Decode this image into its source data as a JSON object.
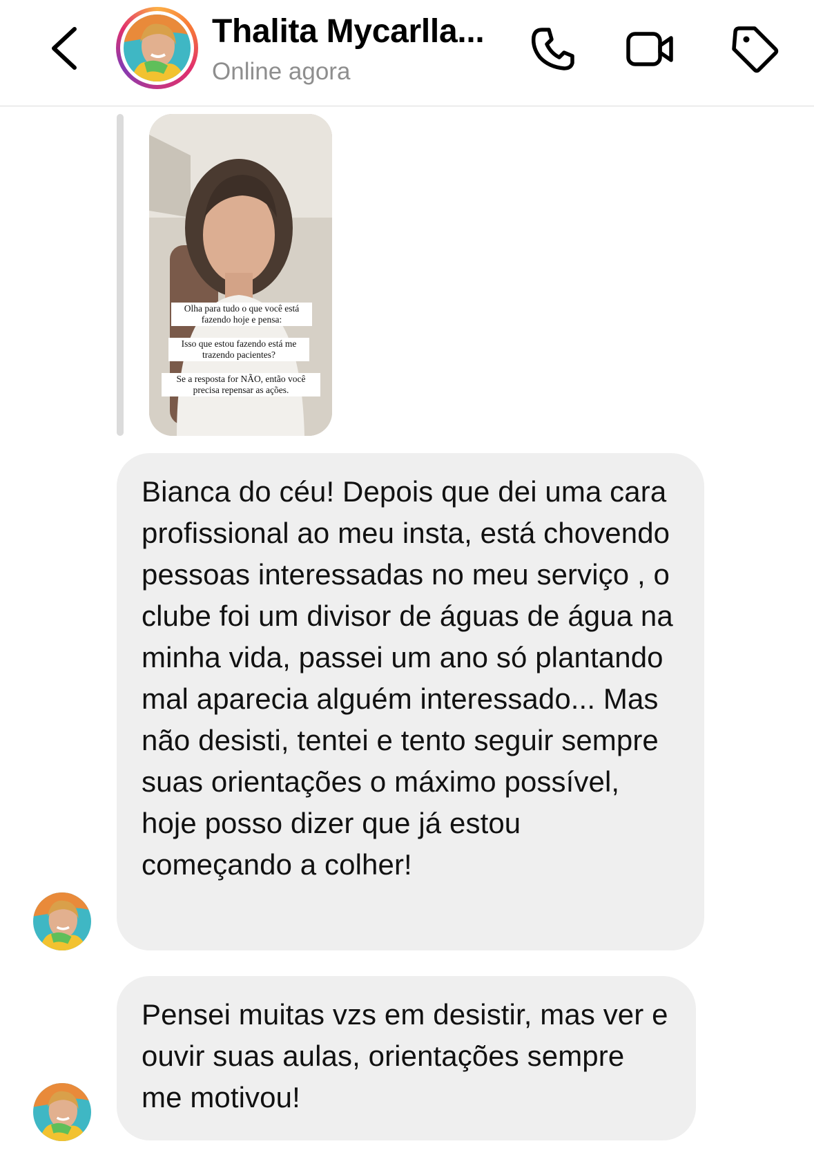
{
  "header": {
    "contact_name": "Thalita Mycarlla...",
    "status": "Online agora",
    "icons": [
      "back-chevron-icon",
      "phone-icon",
      "video-camera-icon",
      "tag-icon"
    ]
  },
  "story_reply": {
    "captions": [
      "Olha para tudo o que você está fazendo hoje e pensa:",
      "Isso que estou fazendo está me trazendo pacientes?",
      "Se a resposta for NÃO, então você precisa repensar as ações."
    ]
  },
  "messages": [
    {
      "text": "Bianca do céu! Depois que dei uma cara profissional ao meu insta, está chovendo pessoas interessadas no meu serviço , o clube foi um divisor de águas de água na minha vida, passei um ano só plantando mal aparecia alguém interessado... Mas não desisti, tentei e tento seguir sempre suas orientações o máximo possível, hoje posso dizer que já estou começando a colher!"
    },
    {
      "text": "Pensei muitas vzs em desistir, mas ver e ouvir suas aulas, orientações sempre me motivou!"
    }
  ],
  "colors": {
    "bubble": "#efefef",
    "status_gray": "#8e8e8e",
    "story_ring": [
      "#fcaf45",
      "#e1306c",
      "#833ab4"
    ]
  }
}
